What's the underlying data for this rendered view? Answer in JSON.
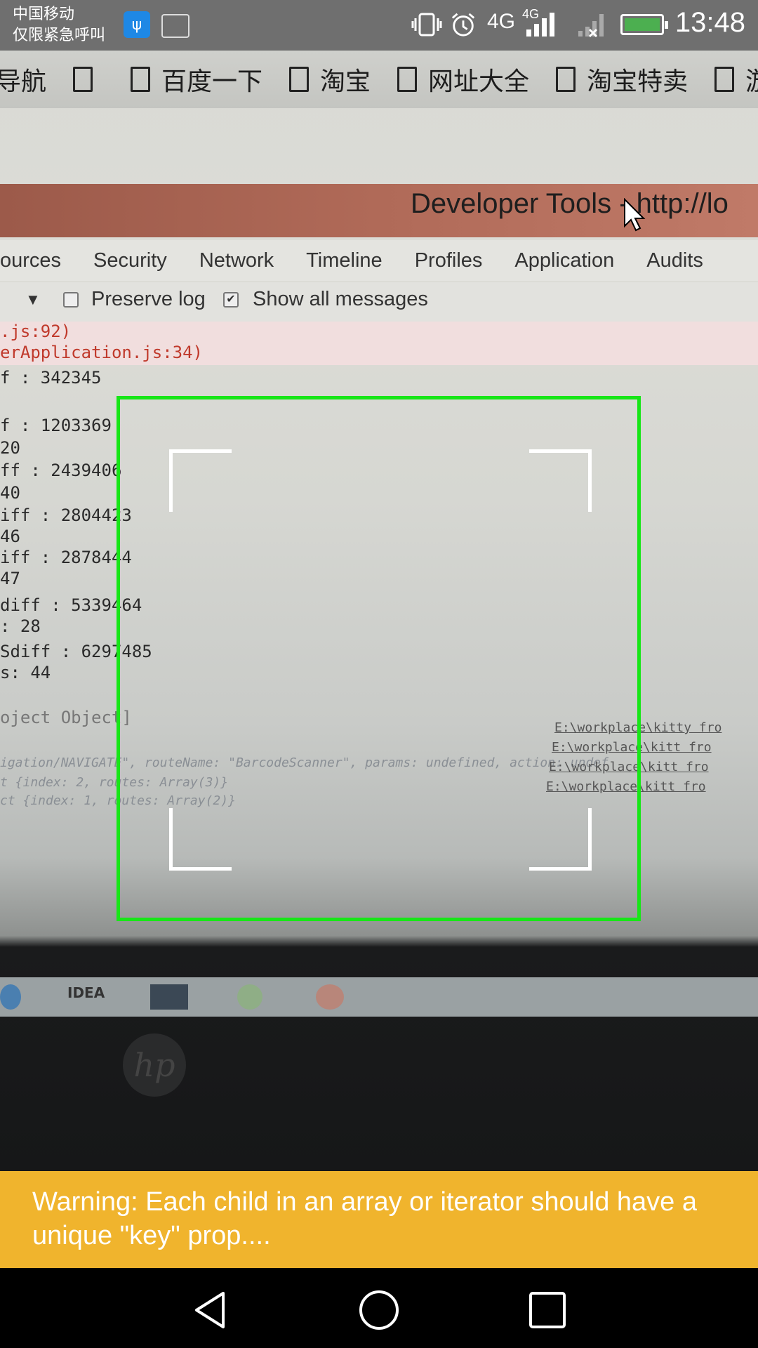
{
  "status_bar": {
    "carrier_line1": "中国移动",
    "carrier_line2": "仅限紧急呼叫",
    "network_1": "4G",
    "network_2": "4G",
    "time": "13:48",
    "icons": [
      "usb-icon",
      "gallery-icon",
      "vibrate-icon",
      "alarm-icon",
      "signal-icon",
      "no-signal-icon",
      "battery-charging-icon"
    ]
  },
  "camera_view": {
    "bookmarks": [
      "导航",
      "",
      "百度一下",
      "淘宝",
      "网址大全",
      "淘宝特卖",
      "游戏"
    ],
    "devtools_title": "Developer Tools - http://lo",
    "devtools_tabs": [
      "ources",
      "Security",
      "Network",
      "Timeline",
      "Profiles",
      "Application",
      "Audits"
    ],
    "toolbar": {
      "preserve_log": "Preserve log",
      "show_all": "Show all messages"
    },
    "console_lines": [
      {
        "text": ".js:92)",
        "style": "red"
      },
      {
        "text": "erApplication.js:34)",
        "style": "red"
      },
      {
        "text": "f : 342345",
        "style": "normal"
      },
      {
        "text": "f : 1203369",
        "style": "normal"
      },
      {
        "text": "20",
        "style": "normal"
      },
      {
        "text": "ff : 2439406",
        "style": "normal"
      },
      {
        "text": "40",
        "style": "normal"
      },
      {
        "text": "iff : 2804423",
        "style": "normal"
      },
      {
        "text": " 46",
        "style": "normal"
      },
      {
        "text": "iff : 2878444",
        "style": "normal"
      },
      {
        "text": " 47",
        "style": "normal"
      },
      {
        "text": "diff : 5339464",
        "style": "normal"
      },
      {
        "text": ": 28",
        "style": "normal"
      },
      {
        "text": "Sdiff : 6297485",
        "style": "normal"
      },
      {
        "text": "s: 44",
        "style": "normal"
      },
      {
        "text": "oject Object]",
        "style": "normal"
      }
    ],
    "faint_lines": [
      "igation/NAVIGATE\", routeName: \"BarcodeScanner\", params: undefined, action: undef",
      "t {index: 2, routes: Array(3)}",
      "ct {index: 1, routes: Array(2)}"
    ],
    "links": [
      "E:\\workplace\\kitty fro",
      "E:\\workplace\\kitt fro",
      "E:\\workplace\\kitt fro",
      "E:\\workplace\\kitt fro"
    ],
    "taskbar_label": "IDEA",
    "laptop_brand": "hp"
  },
  "warning": {
    "text": "Warning: Each child in an array or iterator should have a unique \"key\" prop...."
  },
  "nav_bar": {
    "buttons": [
      "back",
      "home",
      "recents"
    ]
  }
}
